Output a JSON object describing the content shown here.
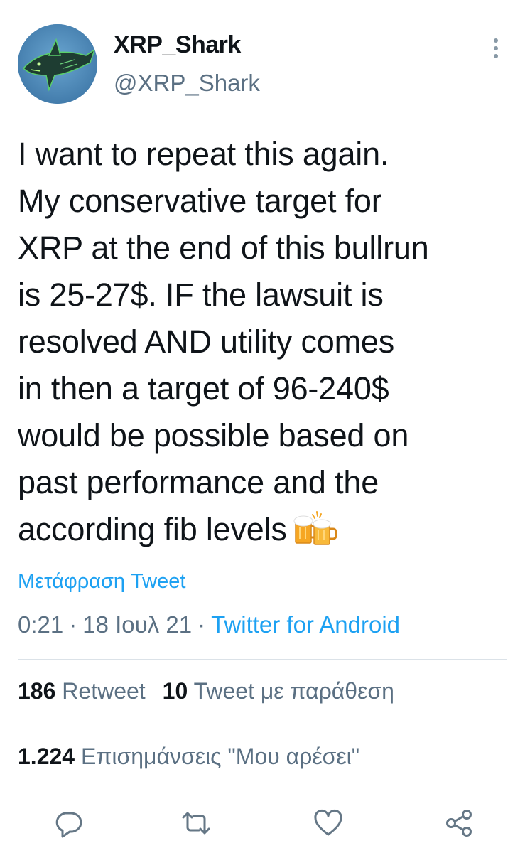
{
  "author": {
    "display_name": "XRP_Shark",
    "handle": "@XRP_Shark",
    "avatar_icon": "shark-avatar"
  },
  "more_icon": "more-vertical-icon",
  "tweet": {
    "lines": [
      "I want to repeat this again.",
      "My conservative target for",
      "XRP at the end of this bullrun",
      "is 25-27$. IF the lawsuit is",
      "resolved AND utility comes",
      "in then a target of 96-240$",
      "would be possible based on",
      "past performance and the",
      "according fib levels"
    ],
    "emoji": "beer-mugs-icon"
  },
  "translate_label": "Μετάφραση Tweet",
  "meta": {
    "time": "0:21",
    "date": "18 Ιουλ 21",
    "separator": "·",
    "source": "Twitter for Android"
  },
  "stats": {
    "retweets_count": "186",
    "retweets_label": "Retweet",
    "quotes_count": "10",
    "quotes_label": "Tweet με παράθεση",
    "likes_count": "1.224",
    "likes_label": "Επισημάνσεις \"Μου αρέσει\""
  },
  "actions": [
    "reply-icon",
    "retweet-icon",
    "like-icon",
    "share-icon"
  ],
  "colors": {
    "link": "#1da1f2",
    "secondary_text": "#5b7083",
    "primary_text": "#0f1419",
    "divider": "#dbe2e8"
  }
}
